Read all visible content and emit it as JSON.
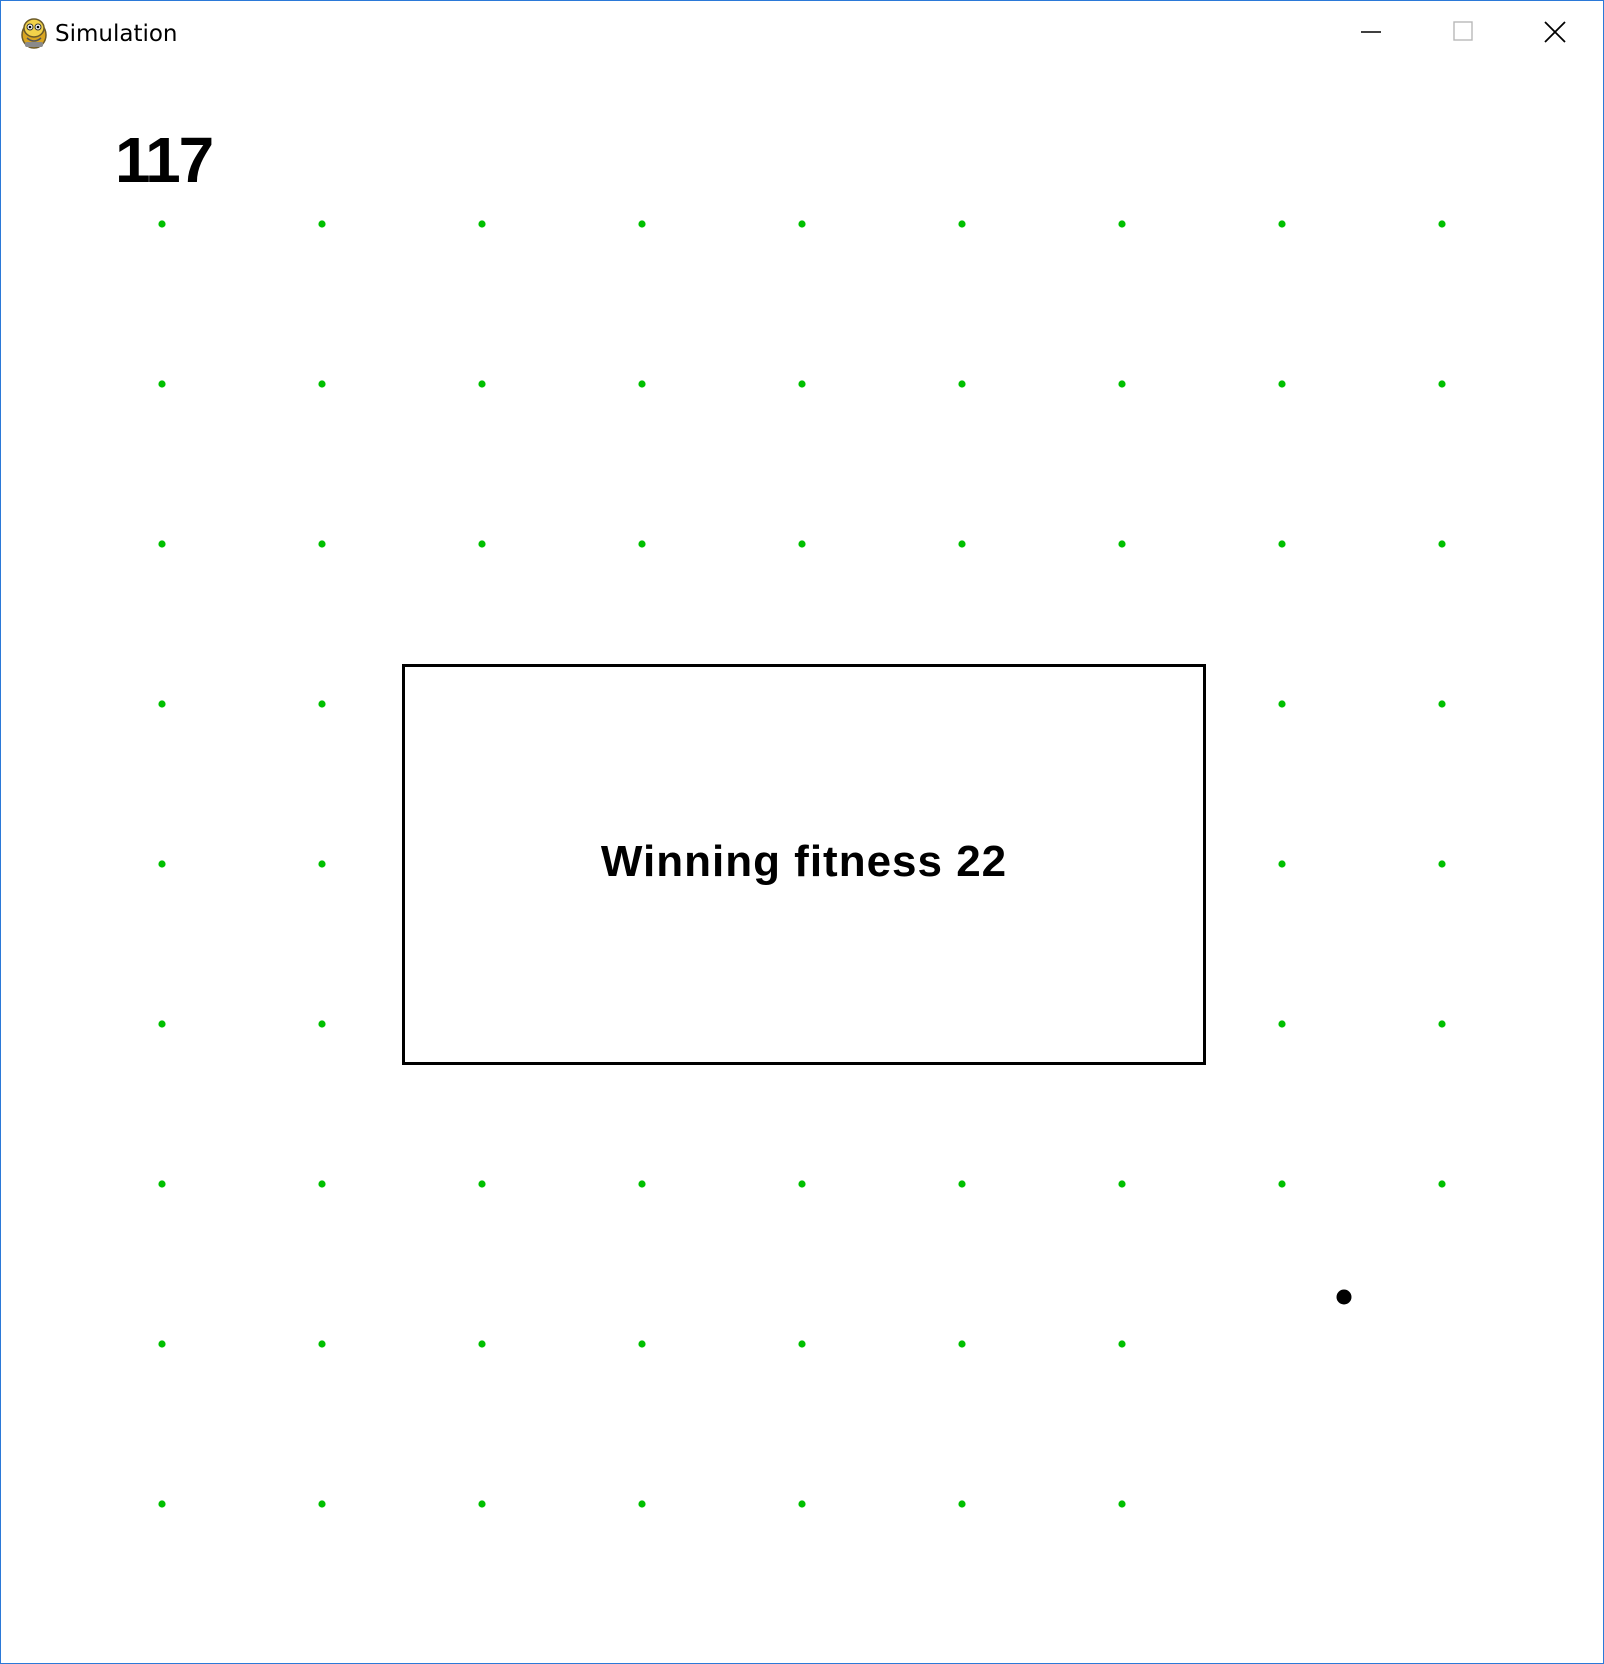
{
  "window": {
    "title": "Simulation",
    "app_icon": "pygame-snake-icon",
    "controls": {
      "minimize_icon": "minimize-icon",
      "maximize_icon": "maximize-icon",
      "close_icon": "close-icon"
    }
  },
  "game": {
    "score": "117",
    "message": "Winning fitness 22",
    "food_color": "#00c000",
    "agent_color": "#000000",
    "grid_columns": 9,
    "grid_rows": 9,
    "eaten_cells": [
      [
        3,
        2
      ],
      [
        3,
        3
      ],
      [
        3,
        4
      ],
      [
        3,
        5
      ],
      [
        3,
        6
      ],
      [
        4,
        2
      ],
      [
        4,
        3
      ],
      [
        4,
        4
      ],
      [
        4,
        5
      ],
      [
        4,
        6
      ],
      [
        5,
        2
      ],
      [
        5,
        3
      ],
      [
        5,
        4
      ],
      [
        5,
        5
      ],
      [
        5,
        6
      ],
      [
        7,
        7
      ],
      [
        7,
        8
      ],
      [
        8,
        7
      ],
      [
        8,
        8
      ]
    ]
  }
}
